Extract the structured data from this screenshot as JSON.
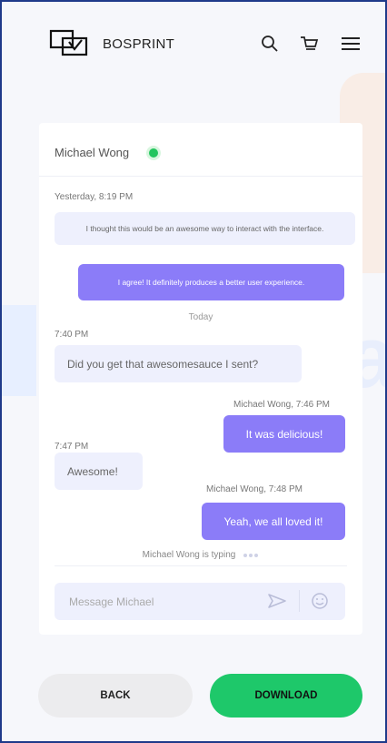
{
  "header": {
    "brand": "BOSPRINT"
  },
  "chat": {
    "contact_name": "Michael Wong",
    "status_color": "#22c55e",
    "messages": [
      {
        "time": "Yesterday, 8:19 PM",
        "dir": "in",
        "text": "I thought this would be an awesome way to interact with the interface."
      },
      {
        "time": "",
        "dir": "out",
        "text": "I agree! It definitely produces a better user experience."
      },
      {
        "separator": "Today"
      },
      {
        "time": "7:40 PM",
        "dir": "in",
        "text": "Did you get that awesomesauce I sent?"
      },
      {
        "time": "Michael Wong, 7:46 PM",
        "dir": "out",
        "text": "It was delicious!"
      },
      {
        "time": "7:47 PM",
        "dir": "in",
        "text": "Awesome!"
      },
      {
        "time": "Michael Wong, 7:48 PM",
        "dir": "out",
        "text": "Yeah, we all loved it!"
      }
    ],
    "typing_indicator": "Michael Wong is typing",
    "input_placeholder": "Message Michael"
  },
  "buttons": {
    "back": "BACK",
    "download": "DOWNLOAD"
  },
  "colors": {
    "accent": "#8b7cf8",
    "incoming": "#eef0fd",
    "download": "#1ec86a",
    "frame": "#1f3a8a"
  },
  "icons": [
    "logo-icon",
    "search-icon",
    "cart-icon",
    "menu-icon",
    "online-status-icon",
    "send-icon",
    "emoji-icon"
  ]
}
